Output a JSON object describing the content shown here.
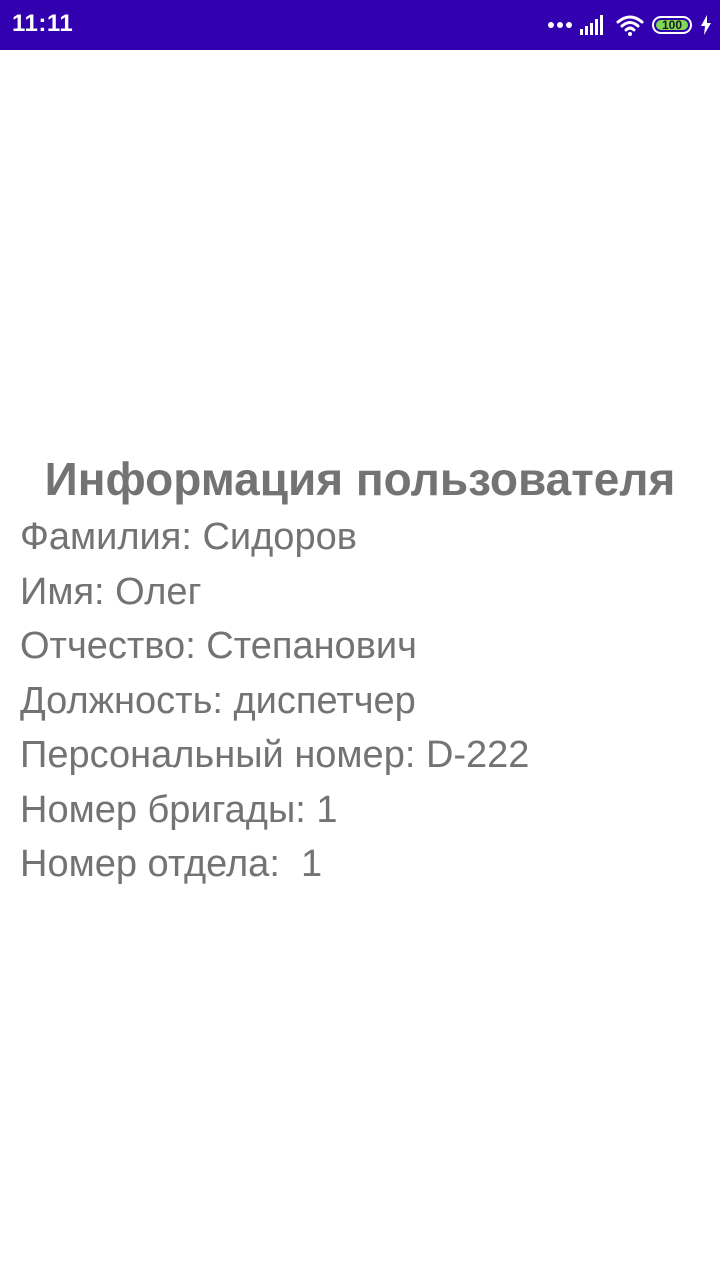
{
  "status_bar": {
    "time": "11:11",
    "battery_level": "100",
    "background_color": "#3300b0",
    "icons": [
      "more-dots-icon",
      "signal-icon",
      "wifi-icon",
      "battery-icon",
      "charging-icon"
    ]
  },
  "main": {
    "title": "Информация пользователя",
    "lines": [
      "Фамилия: Сидоров",
      "Имя: Олег",
      "Отчество: Степанович",
      "Должность: диспетчер",
      "Персональный номер: D-222",
      "Номер бригады: 1",
      "Номер отдела:  1"
    ],
    "text_color": "#737373"
  }
}
